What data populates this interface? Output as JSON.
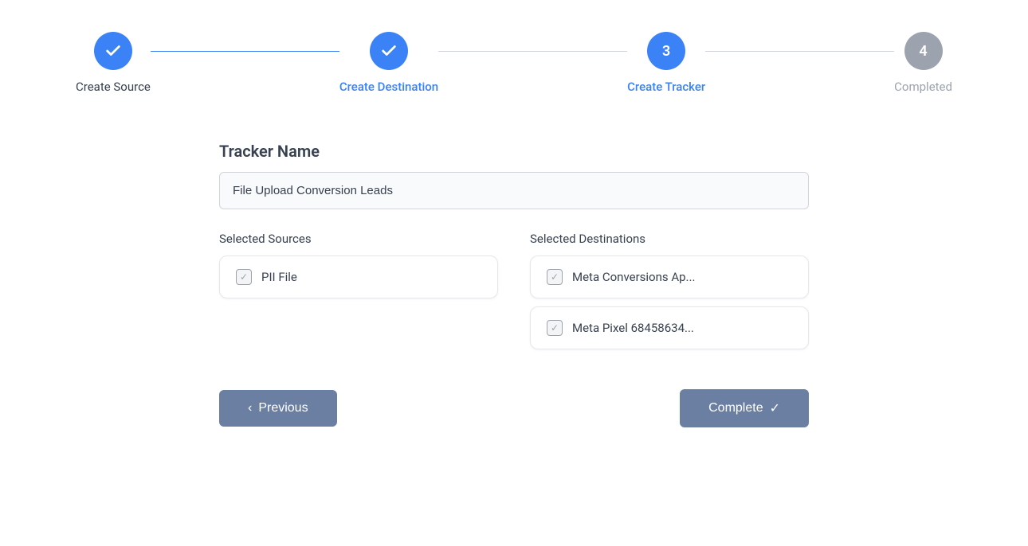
{
  "stepper": {
    "steps": [
      {
        "id": "create-source",
        "label": "Create Source",
        "state": "completed",
        "indicator": "check"
      },
      {
        "id": "create-destination",
        "label": "Create Destination",
        "state": "completed",
        "indicator": "check"
      },
      {
        "id": "create-tracker",
        "label": "Create Tracker",
        "state": "active",
        "indicator": "3"
      },
      {
        "id": "completed",
        "label": "Completed",
        "state": "inactive",
        "indicator": "4"
      }
    ]
  },
  "form": {
    "tracker_name_label": "Tracker Name",
    "tracker_name_value": "File Upload Conversion Leads",
    "tracker_name_placeholder": "File Upload Conversion Leads",
    "selected_sources_label": "Selected Sources",
    "selected_destinations_label": "Selected Destinations",
    "sources": [
      {
        "label": "PII File"
      }
    ],
    "destinations": [
      {
        "label": "Meta Conversions Ap..."
      },
      {
        "label": "Meta Pixel 68458634..."
      }
    ]
  },
  "buttons": {
    "previous_label": "Previous",
    "complete_label": "Complete"
  }
}
